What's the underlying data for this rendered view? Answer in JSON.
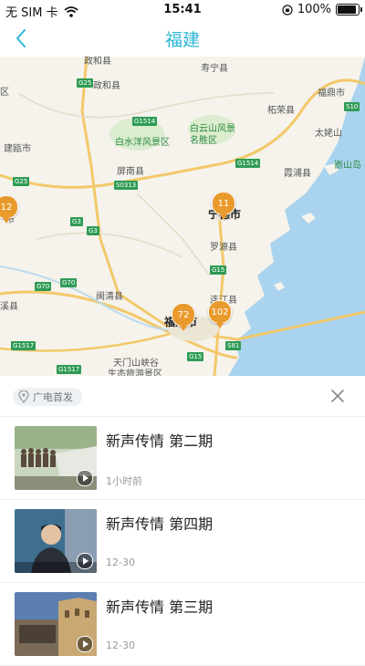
{
  "status_bar": {
    "carrier": "无 SIM 卡",
    "time": "15:41",
    "battery": "100%",
    "battery_level": 1.0
  },
  "nav": {
    "back_icon": "chevron-left-icon",
    "title": "福建"
  },
  "map": {
    "labels": {
      "shouning": "寿宁县",
      "zhenghe": "政和县",
      "fuding": "福鼎市",
      "zherong": "柘荣县",
      "baishuiyang": "白水洋风景区",
      "baiyunshan_1": "白云山风景",
      "baiyunshan_2": "名胜区",
      "taimushan": "太姥山",
      "jianou": "建瓯市",
      "xiapu": "霞浦县",
      "yashandao": "嵛山岛",
      "pingnan": "屏南县",
      "ningde": "宁德市",
      "luoyuan": "罗源县",
      "minqing": "闽清县",
      "lianjiang": "连江县",
      "fuzhou": "福州市",
      "tianmen_1": "天门山峡谷",
      "tianmen_2": "生态旅游景区",
      "edge_qu": "区",
      "edge_shi": "市",
      "edge_xi": "溪县"
    },
    "roads": {
      "g25_a": "G25",
      "g1514_a": "G1514",
      "s10": "S10",
      "g25_b": "G25",
      "g1514_b": "G1514",
      "s0313": "S0313",
      "g3_a": "G3",
      "g3_b": "G3",
      "g15_a": "G15",
      "g70_a": "G70",
      "g70_b": "G70",
      "g1517": "G1517",
      "s81": "S81",
      "g15_b": "G15",
      "g1517_b": "G1517"
    },
    "clusters": {
      "ningde": "11",
      "west": "12",
      "fuzhou": "72",
      "lianjiang": "102"
    }
  },
  "panel": {
    "location_icon": "location-pin-icon",
    "location_label": "广电首发",
    "close_icon": "close-icon",
    "items": [
      {
        "title": "新声传情 第二期",
        "time": "1小时前",
        "thumb_icon": "video-thumbnail"
      },
      {
        "title": "新声传情 第四期",
        "time": "12-30",
        "thumb_icon": "video-thumbnail"
      },
      {
        "title": "新声传情 第三期",
        "time": "12-30",
        "thumb_icon": "video-thumbnail"
      }
    ]
  },
  "colors": {
    "accent": "#2bb7d4",
    "cluster": "#e99a2c",
    "sea": "#a9d3ee",
    "land": "#f5f3ec",
    "highway": "#f2c96a",
    "road_tag": "#2e9b55"
  }
}
